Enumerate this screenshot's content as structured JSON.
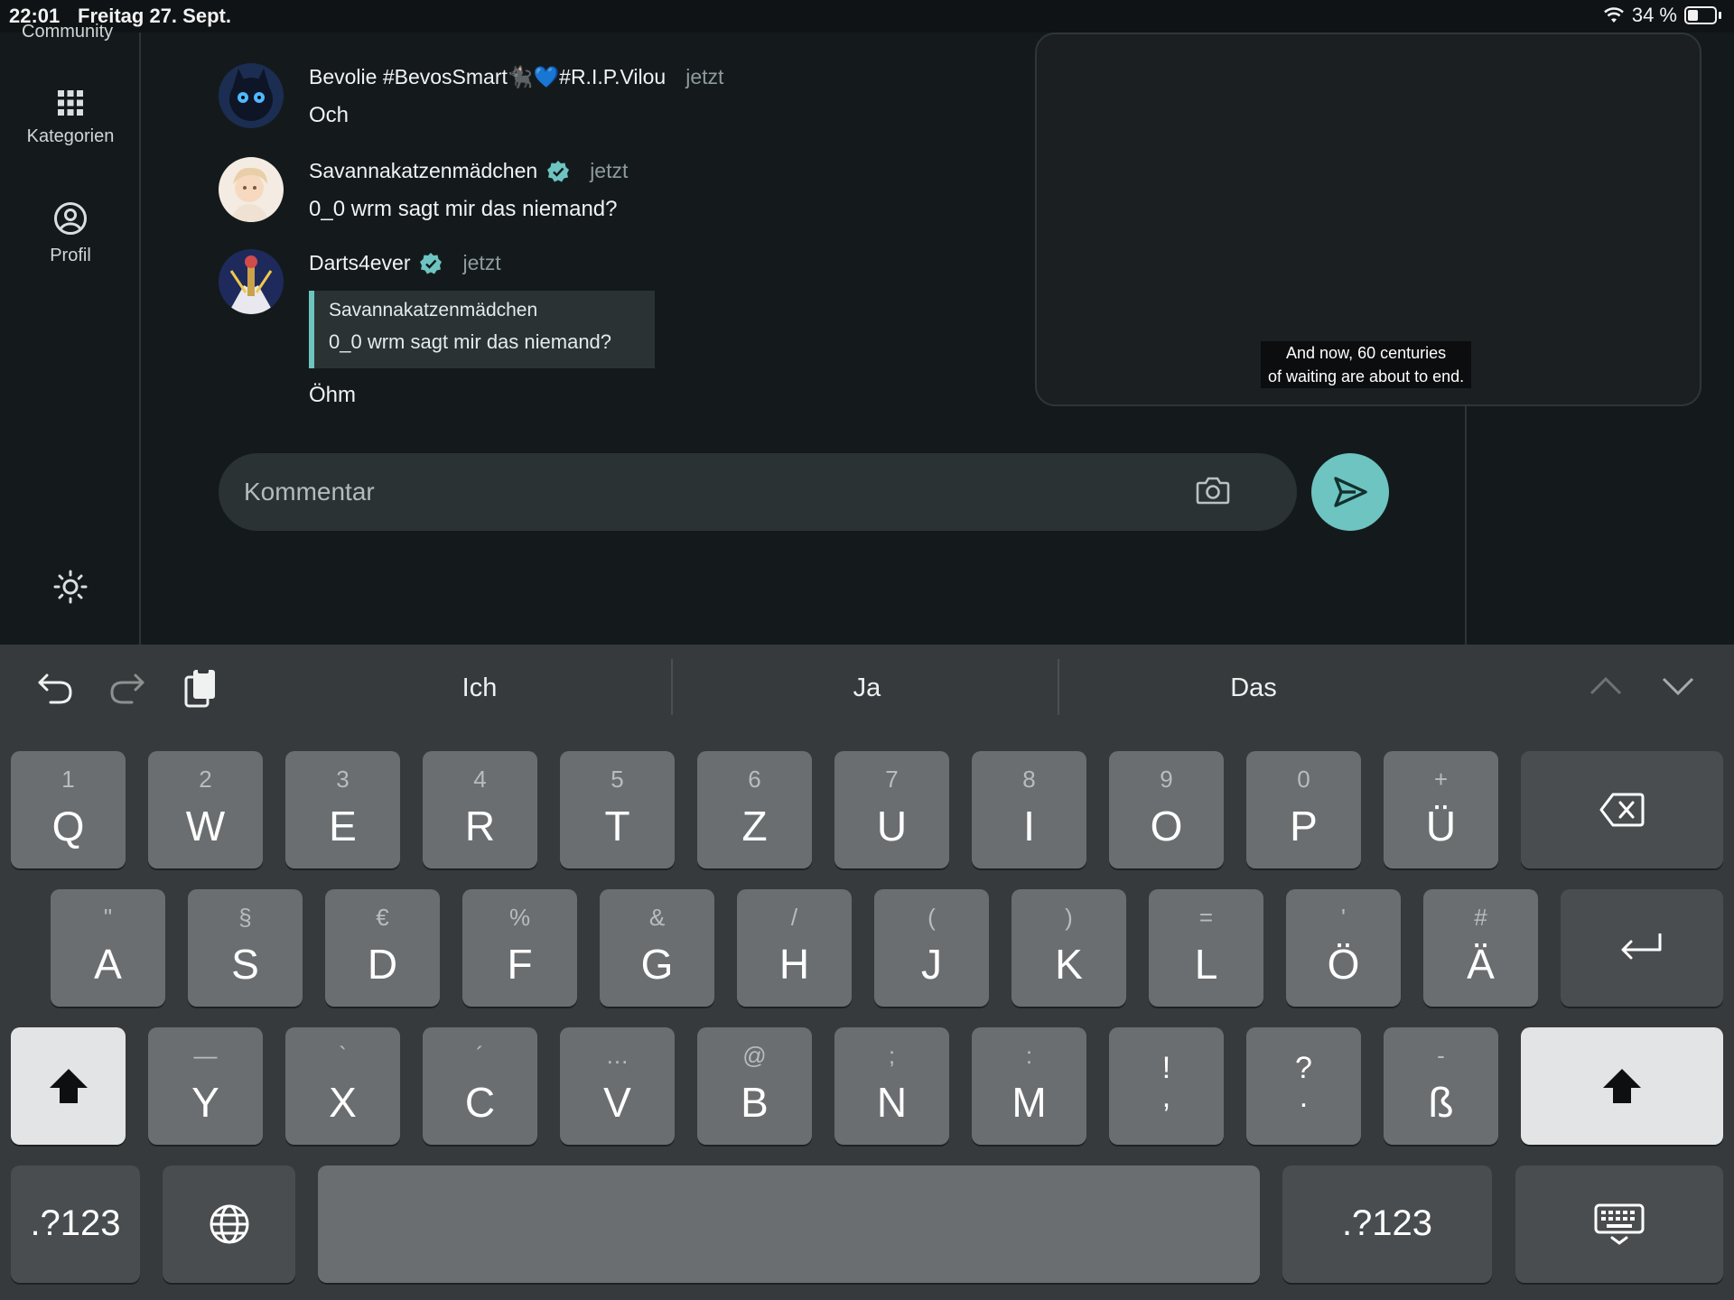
{
  "status": {
    "time": "22:01",
    "date": "Freitag 27. Sept.",
    "battery": "34 %"
  },
  "sidebar": {
    "cut_label": "Community",
    "items": [
      {
        "label": "Kategorien",
        "icon": "grid-icon"
      },
      {
        "label": "Profil",
        "icon": "profile-icon"
      }
    ],
    "settings_icon": "sun-icon"
  },
  "comments": [
    {
      "author": "Bevolie #BevosSmart🐈‍⬛💙#R.I.P.Vilou",
      "time": "jetzt",
      "text": "Och",
      "verified": false
    },
    {
      "author": "Savannakatzenmädchen",
      "time": "jetzt",
      "text": "0_0 wrm sagt mir das niemand?",
      "verified": true
    },
    {
      "author": "Darts4ever",
      "time": "jetzt",
      "text": "Öhm",
      "verified": true,
      "quote": {
        "author": "Savannakatzenmädchen",
        "text": "0_0 wrm sagt mir das niemand?"
      }
    }
  ],
  "composer": {
    "placeholder": "Kommentar",
    "camera_icon": "camera-icon",
    "send_icon": "send-icon"
  },
  "video": {
    "caption_line1": "And now, 60 centuries",
    "caption_line2": "of waiting are about to end."
  },
  "keyboard": {
    "suggestions": [
      "Ich",
      "Ja",
      "Das"
    ],
    "row1": [
      {
        "sub": "1",
        "main": "Q"
      },
      {
        "sub": "2",
        "main": "W"
      },
      {
        "sub": "3",
        "main": "E"
      },
      {
        "sub": "4",
        "main": "R"
      },
      {
        "sub": "5",
        "main": "T"
      },
      {
        "sub": "6",
        "main": "Z"
      },
      {
        "sub": "7",
        "main": "U"
      },
      {
        "sub": "8",
        "main": "I"
      },
      {
        "sub": "9",
        "main": "O"
      },
      {
        "sub": "0",
        "main": "P"
      },
      {
        "sub": "+",
        "main": "Ü"
      }
    ],
    "row2": [
      {
        "sub": "\"",
        "main": "A"
      },
      {
        "sub": "§",
        "main": "S"
      },
      {
        "sub": "€",
        "main": "D"
      },
      {
        "sub": "%",
        "main": "F"
      },
      {
        "sub": "&",
        "main": "G"
      },
      {
        "sub": "/",
        "main": "H"
      },
      {
        "sub": "(",
        "main": "J"
      },
      {
        "sub": ")",
        "main": "K"
      },
      {
        "sub": "=",
        "main": "L"
      },
      {
        "sub": "'",
        "main": "Ö"
      },
      {
        "sub": "#",
        "main": "Ä"
      }
    ],
    "row3": [
      {
        "sub": "—",
        "main": "Y"
      },
      {
        "sub": "`",
        "main": "X"
      },
      {
        "sub": "´",
        "main": "C"
      },
      {
        "sub": "…",
        "main": "V"
      },
      {
        "sub": "@",
        "main": "B"
      },
      {
        "sub": ";",
        "main": "N"
      },
      {
        "sub": ":",
        "main": "M"
      },
      {
        "sub": "!",
        "main": ","
      },
      {
        "sub": "?",
        "main": "."
      },
      {
        "sub": "-",
        "main": "ß"
      }
    ],
    "numbers_label": ".?123"
  }
}
